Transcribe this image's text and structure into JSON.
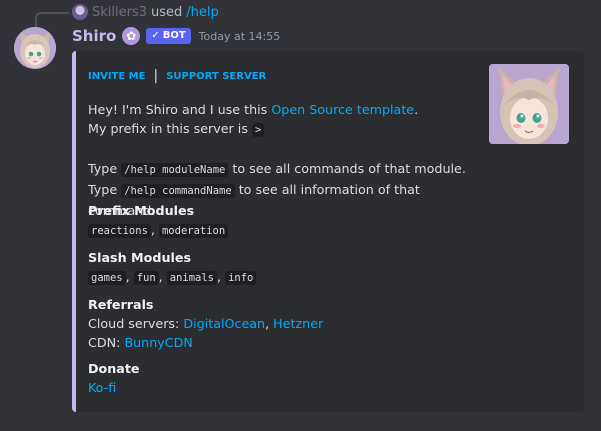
{
  "reply": {
    "user": "Skillers3",
    "used": "used",
    "command": "/help"
  },
  "message": {
    "username": "Shiro",
    "bot_tag": "BOT",
    "timestamp": "Today at 14:55"
  },
  "embed": {
    "links": [
      "INVITE ME",
      "SUPPORT SERVER"
    ],
    "separator": "|",
    "accent_color": "#c9b8ee",
    "description": {
      "line1_pre": "Hey! I'm Shiro and I use this ",
      "line1_link": "Open Source template",
      "line1_post": ".",
      "line2_pre": "My prefix in this server is ",
      "prefix": ">",
      "line3_pre": "Type ",
      "line3_code": "/help moduleName",
      "line3_post": " to see all commands of that module.",
      "line4_pre": "Type ",
      "line4_code": "/help commandName",
      "line4_post": " to see all information of that command."
    },
    "fields": {
      "prefix_modules": {
        "title": "Prefix Modules",
        "items": [
          "reactions",
          "moderation"
        ]
      },
      "slash_modules": {
        "title": "Slash Modules",
        "items": [
          "games",
          "fun",
          "animals",
          "info"
        ]
      },
      "referrals": {
        "title": "Referrals",
        "cloud_label": "Cloud servers: ",
        "cloud_links": [
          "DigitalOcean",
          "Hetzner"
        ],
        "cdn_label": "CDN: ",
        "cdn_link": "BunnyCDN"
      },
      "donate": {
        "title": "Donate",
        "link": "Ko-fi"
      }
    }
  }
}
